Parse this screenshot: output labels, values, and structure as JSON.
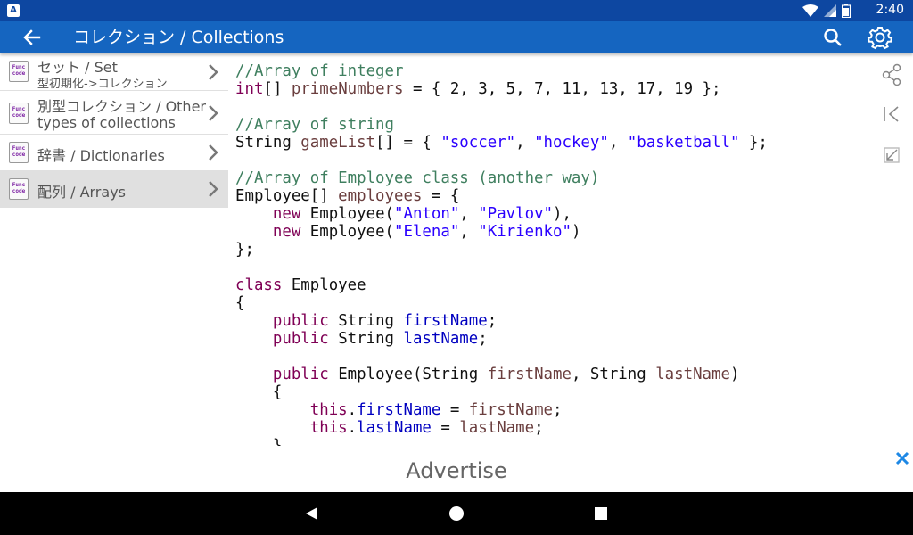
{
  "status_bar": {
    "app_badge": "A",
    "time": "2:40",
    "icons": [
      "wifi-icon",
      "signal-icon",
      "battery-icon"
    ]
  },
  "app_bar": {
    "title": "コレクション / Collections",
    "back_icon": "arrow-left-icon",
    "search_icon": "search-icon",
    "settings_icon": "gear-icon"
  },
  "sidebar": {
    "items": [
      {
        "label": "セット / Set",
        "sublabel": "型初期化->コレクション",
        "icon_text": "Func code",
        "selected": false
      },
      {
        "label": "別型コレクション / Other",
        "sublabel": "types of collections",
        "icon_text": "Func code",
        "selected": false
      },
      {
        "label": "辞書 / Dictionaries",
        "sublabel": "",
        "icon_text": "Func code",
        "selected": false
      },
      {
        "label": "配列 / Arrays",
        "sublabel": "",
        "icon_text": "Func code",
        "selected": true
      }
    ]
  },
  "code_lines": [
    [
      {
        "t": "//Array of integer",
        "c": "c-com"
      }
    ],
    [
      {
        "t": "int",
        "c": "c-kw"
      },
      {
        "t": "[] ",
        "c": ""
      },
      {
        "t": "primeNumbers",
        "c": "c-var"
      },
      {
        "t": " = { 2, 3, 5, 7, 11, 13, 17, 19 };",
        "c": ""
      }
    ],
    [],
    [
      {
        "t": "//Array of string",
        "c": "c-com"
      }
    ],
    [
      {
        "t": "String ",
        "c": ""
      },
      {
        "t": "gameList",
        "c": "c-var"
      },
      {
        "t": "[] = { ",
        "c": ""
      },
      {
        "t": "\"soccer\"",
        "c": "c-str"
      },
      {
        "t": ", ",
        "c": ""
      },
      {
        "t": "\"hockey\"",
        "c": "c-str"
      },
      {
        "t": ", ",
        "c": ""
      },
      {
        "t": "\"basketball\"",
        "c": "c-str"
      },
      {
        "t": " };",
        "c": ""
      }
    ],
    [],
    [
      {
        "t": "//Array of Employee class (another way)",
        "c": "c-com"
      }
    ],
    [
      {
        "t": "Employee[] ",
        "c": ""
      },
      {
        "t": "employees",
        "c": "c-var"
      },
      {
        "t": " = {",
        "c": ""
      }
    ],
    [
      {
        "t": "    ",
        "c": ""
      },
      {
        "t": "new",
        "c": "c-kw"
      },
      {
        "t": " Employee(",
        "c": ""
      },
      {
        "t": "\"Anton\"",
        "c": "c-str"
      },
      {
        "t": ", ",
        "c": ""
      },
      {
        "t": "\"Pavlov\"",
        "c": "c-str"
      },
      {
        "t": "),",
        "c": ""
      }
    ],
    [
      {
        "t": "    ",
        "c": ""
      },
      {
        "t": "new",
        "c": "c-kw"
      },
      {
        "t": " Employee(",
        "c": ""
      },
      {
        "t": "\"Elena\"",
        "c": "c-str"
      },
      {
        "t": ", ",
        "c": ""
      },
      {
        "t": "\"Kirienko\"",
        "c": "c-str"
      },
      {
        "t": ")",
        "c": ""
      }
    ],
    [
      {
        "t": "};",
        "c": ""
      }
    ],
    [],
    [
      {
        "t": "class",
        "c": "c-kw"
      },
      {
        "t": " Employee",
        "c": ""
      }
    ],
    [
      {
        "t": "{",
        "c": ""
      }
    ],
    [
      {
        "t": "    ",
        "c": ""
      },
      {
        "t": "public",
        "c": "c-kw"
      },
      {
        "t": " String ",
        "c": ""
      },
      {
        "t": "firstName",
        "c": "c-fld"
      },
      {
        "t": ";",
        "c": ""
      }
    ],
    [
      {
        "t": "    ",
        "c": ""
      },
      {
        "t": "public",
        "c": "c-kw"
      },
      {
        "t": " String ",
        "c": ""
      },
      {
        "t": "lastName",
        "c": "c-fld"
      },
      {
        "t": ";",
        "c": ""
      }
    ],
    [],
    [
      {
        "t": "    ",
        "c": ""
      },
      {
        "t": "public",
        "c": "c-kw"
      },
      {
        "t": " Employee(String ",
        "c": ""
      },
      {
        "t": "firstName",
        "c": "c-var"
      },
      {
        "t": ", String ",
        "c": ""
      },
      {
        "t": "lastName",
        "c": "c-var"
      },
      {
        "t": ")",
        "c": ""
      }
    ],
    [
      {
        "t": "    {",
        "c": ""
      }
    ],
    [
      {
        "t": "        ",
        "c": ""
      },
      {
        "t": "this",
        "c": "c-kw"
      },
      {
        "t": ".",
        "c": ""
      },
      {
        "t": "firstName",
        "c": "c-fld"
      },
      {
        "t": " = ",
        "c": ""
      },
      {
        "t": "firstName",
        "c": "c-var"
      },
      {
        "t": ";",
        "c": ""
      }
    ],
    [
      {
        "t": "        ",
        "c": ""
      },
      {
        "t": "this",
        "c": "c-kw"
      },
      {
        "t": ".",
        "c": ""
      },
      {
        "t": "lastName",
        "c": "c-fld"
      },
      {
        "t": " = ",
        "c": ""
      },
      {
        "t": "lastName",
        "c": "c-var"
      },
      {
        "t": ";",
        "c": ""
      }
    ],
    [
      {
        "t": "    }",
        "c": ""
      }
    ]
  ],
  "right_tools": [
    "share-icon",
    "skip-to-start-icon",
    "collapse-arrow-icon"
  ],
  "ad_bar": {
    "text": "Advertise",
    "close_icon": "close-icon"
  },
  "nav_bar": {
    "buttons": [
      "back-triangle-icon",
      "home-circle-icon",
      "recents-square-icon"
    ]
  },
  "colors": {
    "status_bar": "#0d47a1",
    "app_bar": "#1565c0",
    "selected_item": "#e0e0e0",
    "comment": "#3f7f5f",
    "keyword": "#7f0055",
    "string": "#2a00ff",
    "field": "#0000c0"
  }
}
